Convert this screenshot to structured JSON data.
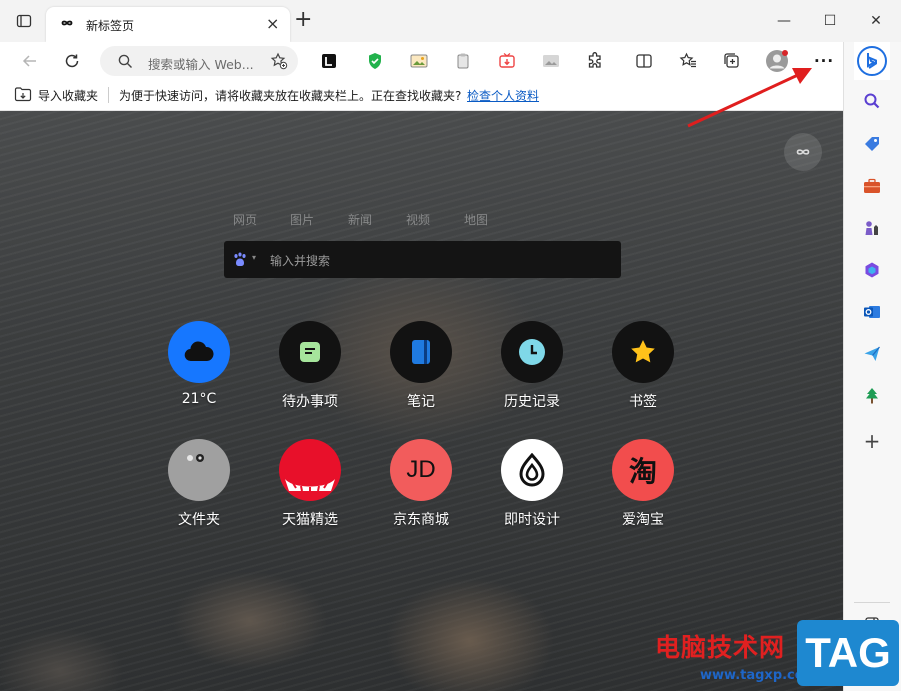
{
  "tab": {
    "title": "新标签页",
    "close": "×"
  },
  "window": {
    "new_tab": "+",
    "minimize": "—",
    "maximize": "☐",
    "close": "✕"
  },
  "omnibox": {
    "placeholder": "搜索或输入 Web..."
  },
  "menu": {
    "more": "···"
  },
  "favorites_bar": {
    "import_label": "导入收藏夹",
    "message": "为便于快速访问，请将收藏夹放在收藏夹栏上。正在查找收藏夹?",
    "link": "检查个人资料"
  },
  "newtab": {
    "nav": [
      "网页",
      "图片",
      "新闻",
      "视频",
      "地图"
    ],
    "search_placeholder": "输入并搜索",
    "shortcuts": [
      {
        "label": "21°C",
        "color": "#1677ff"
      },
      {
        "label": "待办事项",
        "color": "#121212"
      },
      {
        "label": "笔记",
        "color": "#121212"
      },
      {
        "label": "历史记录",
        "color": "#121212"
      },
      {
        "label": "书签",
        "color": "#121212"
      },
      {
        "label": "文件夹",
        "color": "#a0a0a0"
      },
      {
        "label": "天猫精选",
        "color": "#e8102a"
      },
      {
        "label": "京东商城",
        "color": "#f25c5c"
      },
      {
        "label": "即时设计",
        "color": "#ffffff"
      },
      {
        "label": "爱淘宝",
        "color": "#f24d4d"
      }
    ],
    "jd_mark": "JD",
    "taobao_mark": "淘"
  },
  "watermark": {
    "text": "电脑技术网",
    "url": "www.tagxp.com",
    "tag": "TAG"
  }
}
